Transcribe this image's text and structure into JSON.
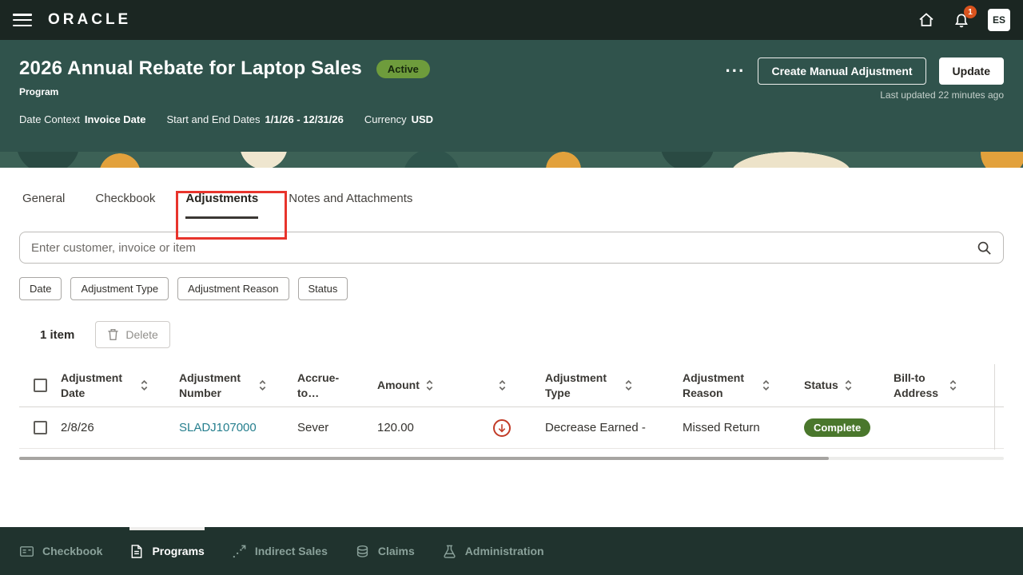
{
  "topbar": {
    "brand": "ORACLE",
    "notification_count": "1",
    "avatar_initials": "ES"
  },
  "header": {
    "title": "2026 Annual Rebate for Laptop Sales",
    "status_badge": "Active",
    "subtitle": "Program",
    "meta": [
      {
        "label": "Date Context",
        "value": "Invoice Date"
      },
      {
        "label": "Start and End Dates",
        "value": "1/1/26 - 12/31/26"
      },
      {
        "label": "Currency",
        "value": "USD"
      }
    ],
    "actions": {
      "more": "···",
      "create_manual_adjustment": "Create Manual Adjustment",
      "update": "Update"
    },
    "last_updated": "Last updated 22 minutes ago"
  },
  "tabs": [
    {
      "label": "General",
      "active": false
    },
    {
      "label": "Checkbook",
      "active": false
    },
    {
      "label": "Adjustments",
      "active": true
    },
    {
      "label": "Notes and Attachments",
      "active": false
    }
  ],
  "search": {
    "placeholder": "Enter customer, invoice or item"
  },
  "filters": [
    "Date",
    "Adjustment Type",
    "Adjustment Reason",
    "Status"
  ],
  "toolbar": {
    "item_count": "1 item",
    "delete_label": "Delete"
  },
  "table": {
    "columns": {
      "date": "Adjustment Date",
      "number": "Adjustment Number",
      "accrue_to": "Accrue-to…",
      "amount": "Amount",
      "type": "Adjustment Type",
      "reason": "Adjustment Reason",
      "status": "Status",
      "bill_to": "Bill-to Address"
    },
    "rows": [
      {
        "adjustment_date": "2/8/26",
        "adjustment_number": "SLADJ107000",
        "accrue_to": "Sever",
        "amount": "120.00",
        "adjustment_type": "Decrease Earned -",
        "adjustment_reason": "Missed Return",
        "status": "Complete",
        "bill_to_address": ""
      }
    ]
  },
  "footer": {
    "items": [
      {
        "label": "Checkbook",
        "active": false
      },
      {
        "label": "Programs",
        "active": true
      },
      {
        "label": "Indirect Sales",
        "active": false
      },
      {
        "label": "Claims",
        "active": false
      },
      {
        "label": "Administration",
        "active": false
      }
    ]
  },
  "colors": {
    "topbar": "#1B2622",
    "header": "#30534C",
    "footer": "#20332E",
    "active_badge": "#6E9C3C",
    "complete_badge": "#4A772C",
    "link": "#267F8E",
    "annotation_red": "#E8342C",
    "accent_orange": "#E2A13C",
    "negative_icon_red": "#C23B27"
  }
}
